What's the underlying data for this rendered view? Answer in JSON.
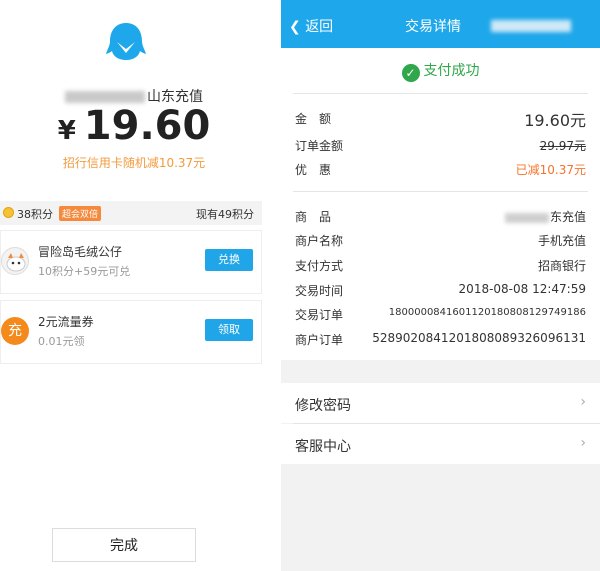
{
  "left": {
    "merchant": "山东充值",
    "amount_symbol": "¥",
    "amount": "19.60",
    "discount_note": "招行信用卡随机减10.37元",
    "points": {
      "my_points": "38积分",
      "badge": "超会双倍",
      "current": "现有49积分"
    },
    "rewards": [
      {
        "name": "冒险岛毛绒公仔",
        "sub": "10积分+59元可兑",
        "button": "兑换",
        "icon": "plush-toy-icon"
      },
      {
        "name": "2元流量券",
        "sub": "0.01元领",
        "button": "领取",
        "icon_text": "充"
      }
    ],
    "done_label": "完成"
  },
  "right": {
    "nav": {
      "back": "返回",
      "title": "交易详情"
    },
    "status": "支付成功",
    "amount_rows": [
      {
        "label": "金　额",
        "value": "19.60元"
      },
      {
        "label": "订单金额",
        "value": "29.97元"
      },
      {
        "label": "优　惠",
        "value": "已减10.37元"
      }
    ],
    "info_rows": [
      {
        "label": "商　品",
        "value": "东充值"
      },
      {
        "label": "商户名称",
        "value": "手机充值"
      },
      {
        "label": "支付方式",
        "value": "招商银行"
      },
      {
        "label": "交易时间",
        "value": "2018-08-08 12:47:59"
      },
      {
        "label": "交易订单",
        "value": "1800000841601120180808129749186"
      },
      {
        "label": "商户订单",
        "value": "5289020841201808089326096131"
      }
    ],
    "menu": [
      {
        "label": "修改密码",
        "arrow": "›"
      },
      {
        "label": "客服中心",
        "arrow": "›"
      }
    ]
  },
  "colors": {
    "accent_blue": "#1ea7ea",
    "success_green": "#2fa74a",
    "discount_orange": "#f5742a"
  }
}
